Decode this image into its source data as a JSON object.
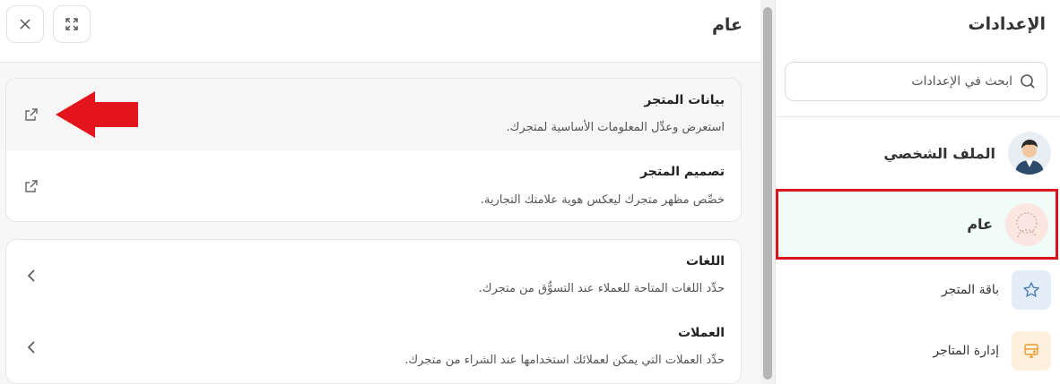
{
  "sidebar": {
    "title": "الإعدادات",
    "search_placeholder": "ابحث في الإعدادات",
    "items": [
      {
        "label": "الملف الشخصي",
        "icon": "user-avatar"
      },
      {
        "label": "عام",
        "icon": "settings-avatar",
        "active": true
      },
      {
        "label": "باقة المتجر",
        "icon": "star-icon"
      },
      {
        "label": "إدارة المتاجر",
        "icon": "stores-icon"
      }
    ]
  },
  "main": {
    "title": "عام",
    "group1": [
      {
        "title": "بيانات المتجر",
        "description": "استعرض وعدِّل المعلومات الأساسية لمتجرك."
      },
      {
        "title": "تصميم المتجر",
        "description": "خصِّص مظهر متجرك ليعكس هوية علامتك التجارية."
      }
    ],
    "group2": [
      {
        "title": "اللغات",
        "description": "حدِّد اللغات المتاحة للعملاء عند التسوُّق من متجرك."
      },
      {
        "title": "العملات",
        "description": "حدِّد العملات التي يمكن لعملائك استخدامها عند الشراء من متجرك."
      }
    ]
  },
  "colors": {
    "highlight_border": "#d9141e",
    "active_bg": "#effcf8",
    "arrow": "#e3141c"
  }
}
